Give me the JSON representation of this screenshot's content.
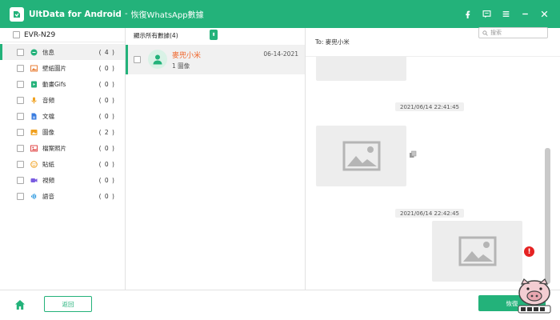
{
  "titlebar": {
    "app_name": "UltData for Android",
    "separator": "-",
    "subtitle": "恢復WhatsApp數據",
    "icons": [
      "facebook-icon",
      "feedback-icon",
      "menu-icon",
      "minimize-icon",
      "close-icon"
    ]
  },
  "colors": {
    "accent": "#23b27a",
    "contact_name": "#f0652a",
    "error": "#e52222"
  },
  "device": {
    "name": "EVR-N29"
  },
  "categories": [
    {
      "label": "信息",
      "count": "( 4 )",
      "icon": "message-icon",
      "color": "#23b27a",
      "active": true
    },
    {
      "label": "壁紙圖片",
      "count": "( 0 )",
      "icon": "wallpaper-icon",
      "color": "#e8803a"
    },
    {
      "label": "動畫Gifs",
      "count": "( 0 )",
      "icon": "gif-icon",
      "color": "#23b27a"
    },
    {
      "label": "音頻",
      "count": "( 0 )",
      "icon": "microphone-icon",
      "color": "#f0a01e"
    },
    {
      "label": "文檔",
      "count": "( 0 )",
      "icon": "document-icon",
      "color": "#3a7de0"
    },
    {
      "label": "圖像",
      "count": "( 2 )",
      "icon": "image-icon",
      "color": "#f0a01e"
    },
    {
      "label": "檔案照片",
      "count": "( 0 )",
      "icon": "profile-photo-icon",
      "color": "#e04848"
    },
    {
      "label": "貼紙",
      "count": "( 0 )",
      "icon": "sticker-icon",
      "color": "#f0a01e"
    },
    {
      "label": "視頻",
      "count": "( 0 )",
      "icon": "video-icon",
      "color": "#7a5ce0"
    },
    {
      "label": "語音",
      "count": "( 0 )",
      "icon": "voice-icon",
      "color": "#2f9ae0"
    }
  ],
  "filter": {
    "label": "顯示所有數據(4)"
  },
  "chat": {
    "name": "麥兜小米",
    "subtitle": "1 圖像",
    "date": "06-14-2021"
  },
  "search": {
    "placeholder": "搜索"
  },
  "conversation": {
    "to_label": "To: 麥兜小米",
    "timestamps": [
      "2021/06/14 22:41:45",
      "2021/06/14 22:42:45"
    ]
  },
  "footer": {
    "back_label": "返回",
    "recover_label": "恢復"
  }
}
